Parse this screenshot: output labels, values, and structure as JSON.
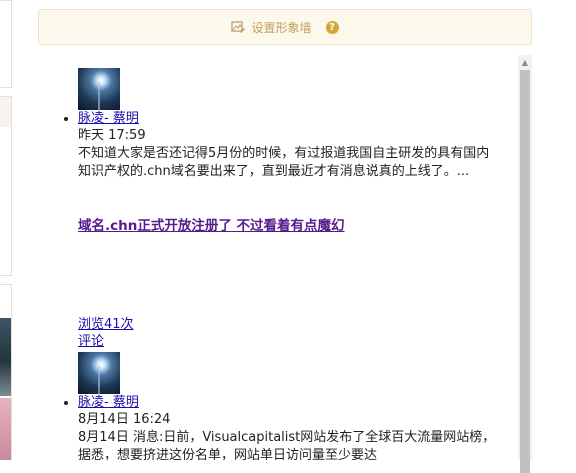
{
  "topbar": {
    "label": "设置形象墙",
    "icon": "image-edit-icon",
    "help_icon": "question-icon",
    "help_mark": "?"
  },
  "posts": [
    {
      "author": "脉凌- 蔡明",
      "time": "昨天 17:59",
      "excerpt": "不知道大家是否还记得5月份的时候，有过报道我国自主研发的具有国内知识产权的.chn域名要出来了，直到最近才有消息说真的上线了。...",
      "title": "域名.chn正式开放注册了 不过看着有点魔幻",
      "views": "浏览41次",
      "comments": "评论"
    },
    {
      "author": "脉凌- 蔡明",
      "time": "8月14日 16:24",
      "excerpt": "8月14日 消息:日前，Visualcapitalist网站发布了全球百大流量网站榜，据悉，想要挤进这份名单，网站单日访问量至少要达"
    }
  ],
  "scrollbar": {
    "up_arrow": "▲"
  }
}
